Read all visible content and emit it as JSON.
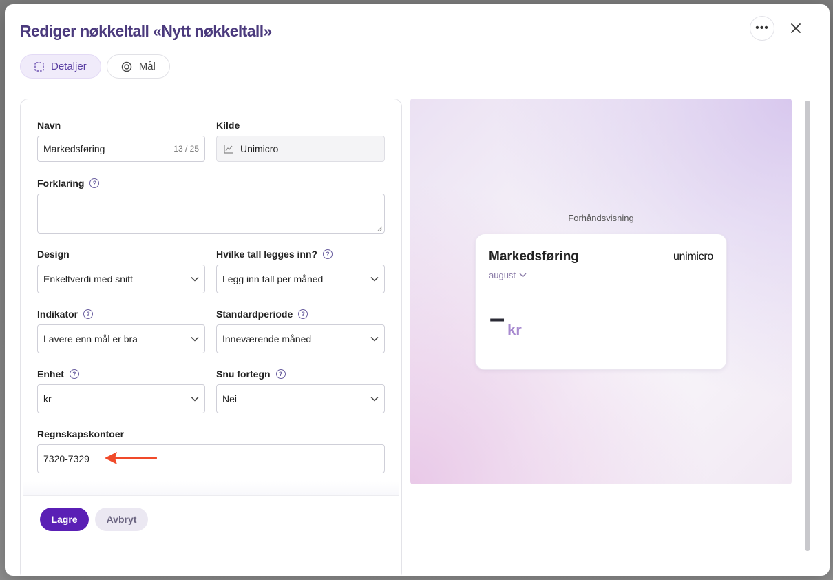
{
  "dialog": {
    "title": "Rediger nøkkeltall «Nytt nøkkeltall»",
    "more_icon": "more-horizontal-icon",
    "close_icon": "close-icon"
  },
  "tabs": [
    {
      "label": "Detaljer",
      "icon": "dashed-square-icon",
      "active": true
    },
    {
      "label": "Mål",
      "icon": "target-icon",
      "active": false
    }
  ],
  "form": {
    "navn": {
      "label": "Navn",
      "value": "Markedsføring",
      "counter": "13 / 25"
    },
    "kilde": {
      "label": "Kilde",
      "value": "Unimicro",
      "icon": "line-chart-icon"
    },
    "forklaring": {
      "label": "Forklaring",
      "value": ""
    },
    "design": {
      "label": "Design",
      "value": "Enkeltverdi med snitt"
    },
    "hvilke_tall": {
      "label": "Hvilke tall legges inn?",
      "value": "Legg inn tall per måned"
    },
    "indikator": {
      "label": "Indikator",
      "value": "Lavere enn mål er bra"
    },
    "standardperiode": {
      "label": "Standardperiode",
      "value": "Inneværende måned"
    },
    "enhet": {
      "label": "Enhet",
      "value": "kr"
    },
    "snu_fortegn": {
      "label": "Snu fortegn",
      "value": "Nei"
    },
    "regnskapskontoer": {
      "label": "Regnskapskontoer",
      "value": "7320-7329"
    }
  },
  "buttons": {
    "save": "Lagre",
    "cancel": "Avbryt"
  },
  "annotation": {
    "color": "#f04a2a"
  },
  "preview": {
    "label": "Forhåndsvisning",
    "card": {
      "title": "Markedsføring",
      "logo": "unimicro",
      "period": "august",
      "value": "–",
      "unit": "kr"
    }
  },
  "colors": {
    "title": "#4b3a7d",
    "primary": "#5a1fb5",
    "tab_active_bg": "#f0ebfa"
  }
}
